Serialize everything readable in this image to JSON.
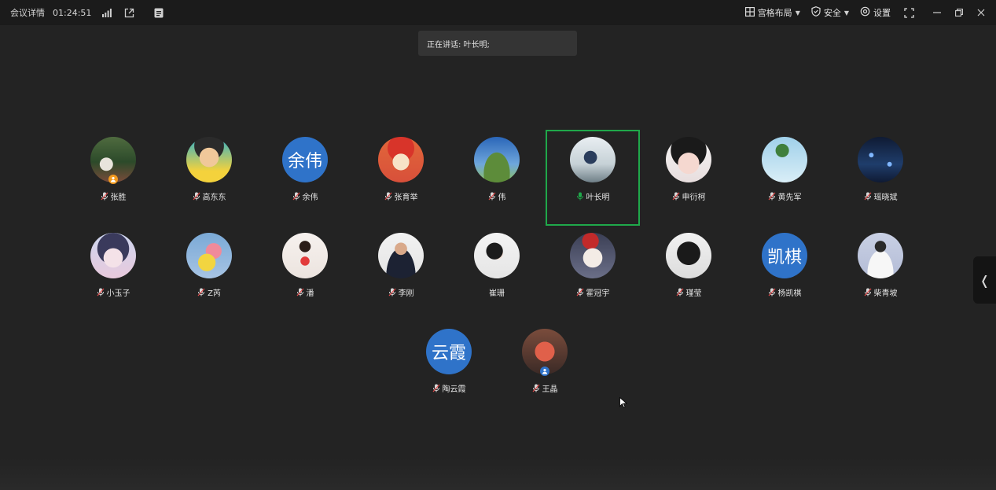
{
  "topbar": {
    "meeting_details": "会议详情",
    "timer": "01:24:51",
    "layout_label": "宫格布局",
    "security_label": "安全",
    "settings_label": "设置"
  },
  "speaking": {
    "text": "正在讲话: 叶长明;"
  },
  "colors": {
    "active_border": "#1fa84a",
    "text_avatar": "#2f73c9",
    "host_badge": "#f39b1f",
    "cohost_badge": "#2f73c9"
  },
  "participants": [
    {
      "name": "张胜",
      "avatar_type": "photo",
      "avatar_icon": "garden-photo",
      "badge": "host"
    },
    {
      "name": "高东东",
      "avatar_type": "photo",
      "avatar_icon": "cartoon-man-photo"
    },
    {
      "name": "余伟",
      "avatar_type": "text",
      "avatar_text": "余伟"
    },
    {
      "name": "张育举",
      "avatar_type": "photo",
      "avatar_icon": "cartoon-kid-photo"
    },
    {
      "name": "伟",
      "avatar_type": "photo",
      "avatar_icon": "sky-field-photo"
    },
    {
      "name": "叶长明",
      "avatar_type": "photo",
      "avatar_icon": "man-sitting-photo",
      "active": true
    },
    {
      "name": "申衍柯",
      "avatar_type": "photo",
      "avatar_icon": "plush-toy-photo"
    },
    {
      "name": "黄先军",
      "avatar_type": "photo",
      "avatar_icon": "palm-tree-photo"
    },
    {
      "name": "瑶晓斌",
      "avatar_type": "photo",
      "avatar_icon": "night-lights-photo"
    },
    {
      "name": "小玉子",
      "avatar_type": "photo",
      "avatar_icon": "anime-girl-photo"
    },
    {
      "name": "Z芮",
      "avatar_type": "photo",
      "avatar_icon": "cartoon-sponge-photo"
    },
    {
      "name": "潘",
      "avatar_type": "photo",
      "avatar_icon": "woman-heart-photo"
    },
    {
      "name": "李刚",
      "avatar_type": "photo",
      "avatar_icon": "man-suit-photo"
    },
    {
      "name": "崔珊",
      "avatar_type": "photo",
      "avatar_icon": "woman-portrait-photo",
      "no_mic": true
    },
    {
      "name": "霍冠宇",
      "avatar_type": "photo",
      "avatar_icon": "anime-boy-photo"
    },
    {
      "name": "瑾莹",
      "avatar_type": "photo",
      "avatar_icon": "dark-hair-girl-photo"
    },
    {
      "name": "杨凯棋",
      "avatar_type": "text",
      "avatar_text": "凯棋"
    },
    {
      "name": "柴青坡",
      "avatar_type": "photo",
      "avatar_icon": "woman-white-coat-photo"
    },
    {
      "name": "陶云霞",
      "avatar_type": "text",
      "avatar_text": "云霞"
    },
    {
      "name": "王晶",
      "avatar_type": "photo",
      "avatar_icon": "neon-sign-photo",
      "badge": "cohost"
    }
  ]
}
